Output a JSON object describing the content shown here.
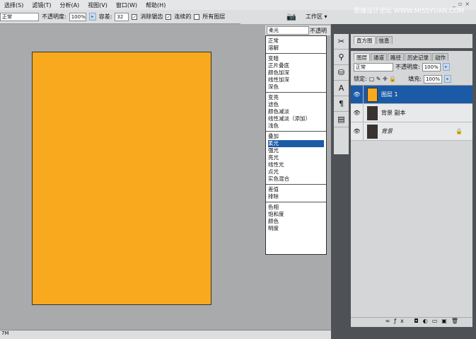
{
  "menu": [
    "选择(S)",
    "滤镜(T)",
    "分析(A)",
    "视图(V)",
    "窗口(W)",
    "帮助(H)"
  ],
  "options": {
    "mode": "正常",
    "opacity_label": "不透明度:",
    "opacity": "100%",
    "tolerance_label": "容差:",
    "tolerance": "32",
    "antialias": "消除锯齿",
    "contiguous": "连续的",
    "all_layers": "所有图层"
  },
  "workspace_label": "工作区 ▾",
  "watermark": "思缘设计论坛  WWW.MISSYUAN.COM",
  "blend": {
    "current": "柔光",
    "opacity_label": "不透明度",
    "groups": [
      [
        "正常",
        "溶解"
      ],
      [
        "变暗",
        "正片叠底",
        "颜色加深",
        "线性加深",
        "深色"
      ],
      [
        "变亮",
        "滤色",
        "颜色减淡",
        "线性减淡（添加）",
        "浅色"
      ],
      [
        "叠加",
        "柔光",
        "强光",
        "亮光",
        "线性光",
        "点光",
        "实色混合"
      ],
      [
        "差值",
        "排除"
      ],
      [
        "色相",
        "饱和度",
        "颜色",
        "明度"
      ]
    ],
    "selected": "柔光"
  },
  "panels": {
    "top_tabs": [
      "直方图",
      "信息"
    ],
    "layer_tabs": [
      "图层",
      "通道",
      "路径",
      "历史记录",
      "动作"
    ],
    "blend_mode": "正常",
    "opacity_label": "不透明度:",
    "opacity": "100%",
    "lock_label": "锁定:",
    "fill_label": "填充:",
    "fill": "100%",
    "layers": [
      {
        "name": "图层 1",
        "color": "#f9a91d"
      },
      {
        "name": "背景 副本",
        "color": "#3a3230"
      },
      {
        "name": "背景",
        "color": "#3a3230"
      }
    ]
  },
  "status": "7M",
  "colors": {
    "canvas": "#f9a91d",
    "selection": "#1a5aa6"
  }
}
